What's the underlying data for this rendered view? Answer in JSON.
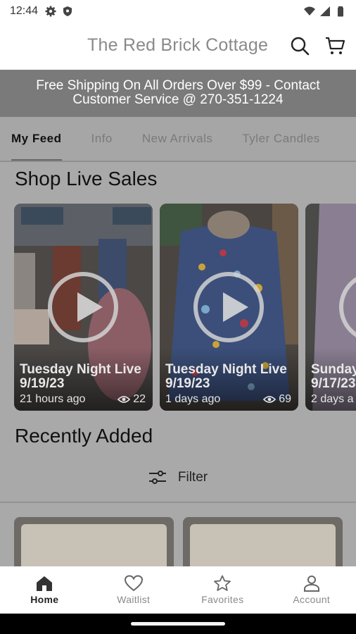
{
  "status_bar": {
    "time": "12:44",
    "left_icons": [
      "gear-icon",
      "shield-icon"
    ],
    "right_icons": [
      "wifi-icon",
      "signal-icon",
      "battery-icon"
    ]
  },
  "header": {
    "title": "The Red Brick Cottage",
    "icons": [
      "search-icon",
      "cart-icon"
    ]
  },
  "banner": {
    "line1": "Free Shipping On All Orders Over $99 - Contact",
    "line2": "Customer Service @ 270-351-1224"
  },
  "tabs": [
    {
      "label": "My Feed",
      "active": true
    },
    {
      "label": "Info",
      "active": false
    },
    {
      "label": "New Arrivals",
      "active": false
    },
    {
      "label": "Tyler Candles",
      "active": false
    }
  ],
  "live_sales": {
    "title": "Shop Live Sales",
    "cards": [
      {
        "name_line1": "Tuesday Night Live",
        "name_line2": "9/19/23",
        "time": "21 hours ago",
        "views": "22"
      },
      {
        "name_line1": "Tuesday Night Live",
        "name_line2": "9/19/23",
        "time": "1 days ago",
        "views": "69"
      },
      {
        "name_line1": "Sunday",
        "name_line2": "9/17/23",
        "time": "2 days a",
        "views": ""
      }
    ]
  },
  "recently_added": {
    "title": "Recently Added",
    "filter_label": "Filter"
  },
  "bottom_nav": [
    {
      "label": "Home",
      "icon": "home-icon",
      "active": true
    },
    {
      "label": "Waitlist",
      "icon": "heart-icon",
      "active": false
    },
    {
      "label": "Favorites",
      "icon": "star-icon",
      "active": false
    },
    {
      "label": "Account",
      "icon": "account-icon",
      "active": false
    }
  ],
  "colors": {
    "overlay": "#a9a9a9",
    "banner_bg": "#7a7a7a",
    "header_title": "#8a8a8a"
  }
}
